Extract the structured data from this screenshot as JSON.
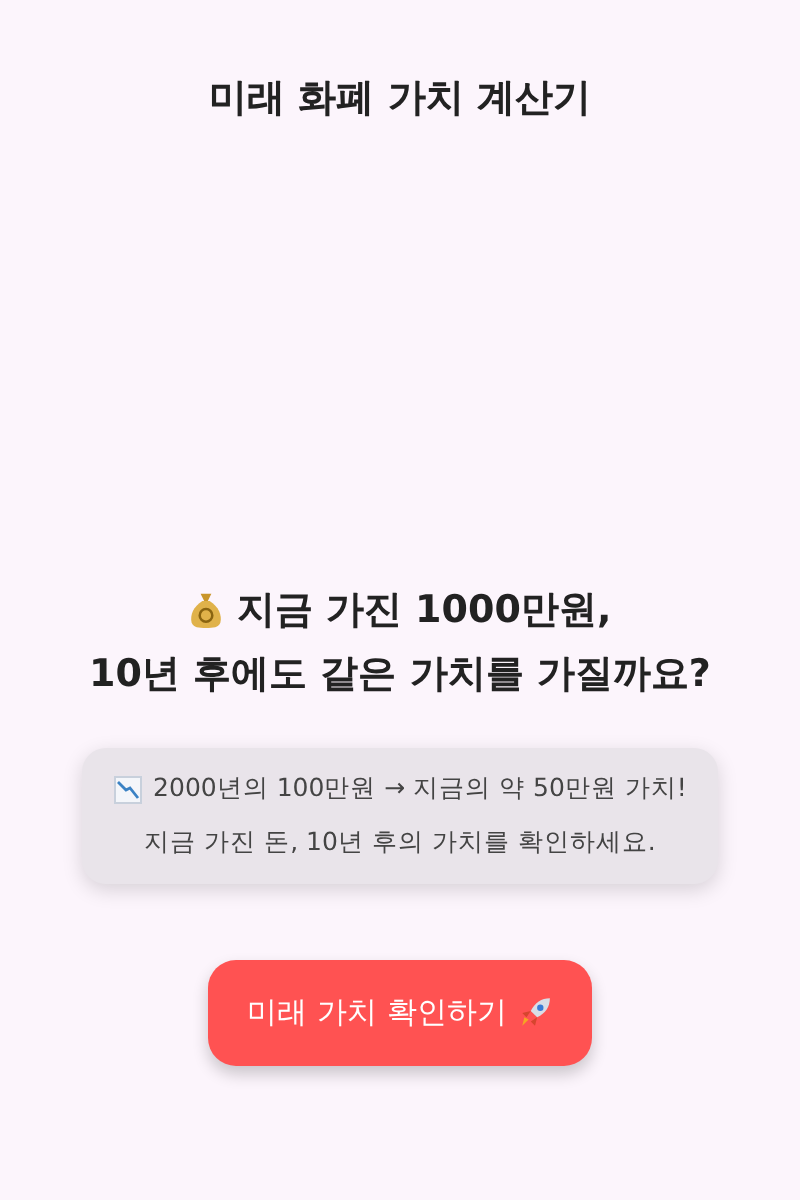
{
  "title": "미래 화폐 가치 계산기",
  "headline": {
    "lines": [
      "지금 가진 1000만원,",
      "10년 후에도 같은 가치를 가질까요?"
    ]
  },
  "info_card": {
    "lines": [
      "2000년의 100만원 → 지금의 약 50만원 가치!",
      "지금 가진 돈, 10년 후의 가치를 확인하세요."
    ]
  },
  "button": {
    "label": "미래 가치 확인하기"
  }
}
